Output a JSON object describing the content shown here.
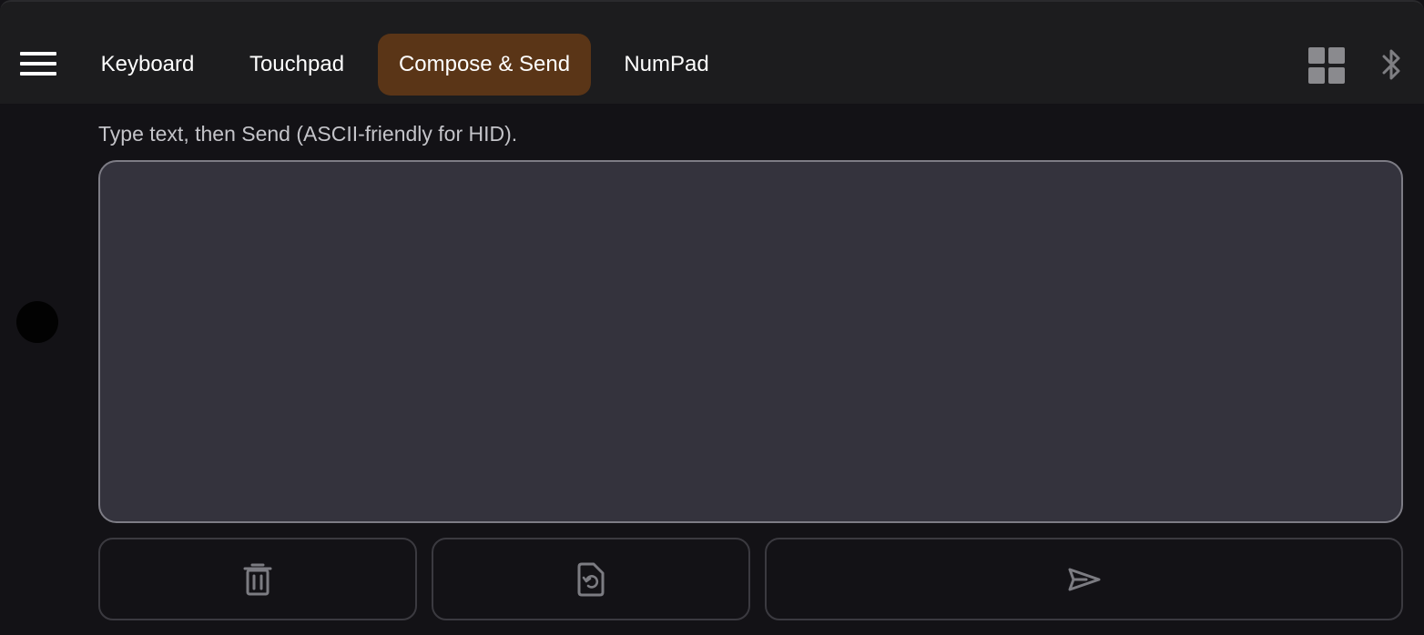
{
  "tabs": [
    {
      "label": "Keyboard",
      "active": false
    },
    {
      "label": "Touchpad",
      "active": false
    },
    {
      "label": "Compose & Send",
      "active": true
    },
    {
      "label": "NumPad",
      "active": false
    }
  ],
  "toolbar": {
    "menu_icon": "hamburger-icon",
    "layout_icon": "grid-icon",
    "connection_icon": "bluetooth-icon"
  },
  "compose": {
    "hint": "Type text, then Send (ASCII-friendly for HID).",
    "value": "",
    "placeholder": ""
  },
  "actions": [
    {
      "icon": "trash-icon"
    },
    {
      "icon": "document-restore-icon"
    },
    {
      "icon": "send-icon"
    }
  ],
  "colors": {
    "active_tab": "#5a3517",
    "topbar": "#1c1c1e",
    "background": "#131216",
    "input_bg": "#34333d"
  }
}
